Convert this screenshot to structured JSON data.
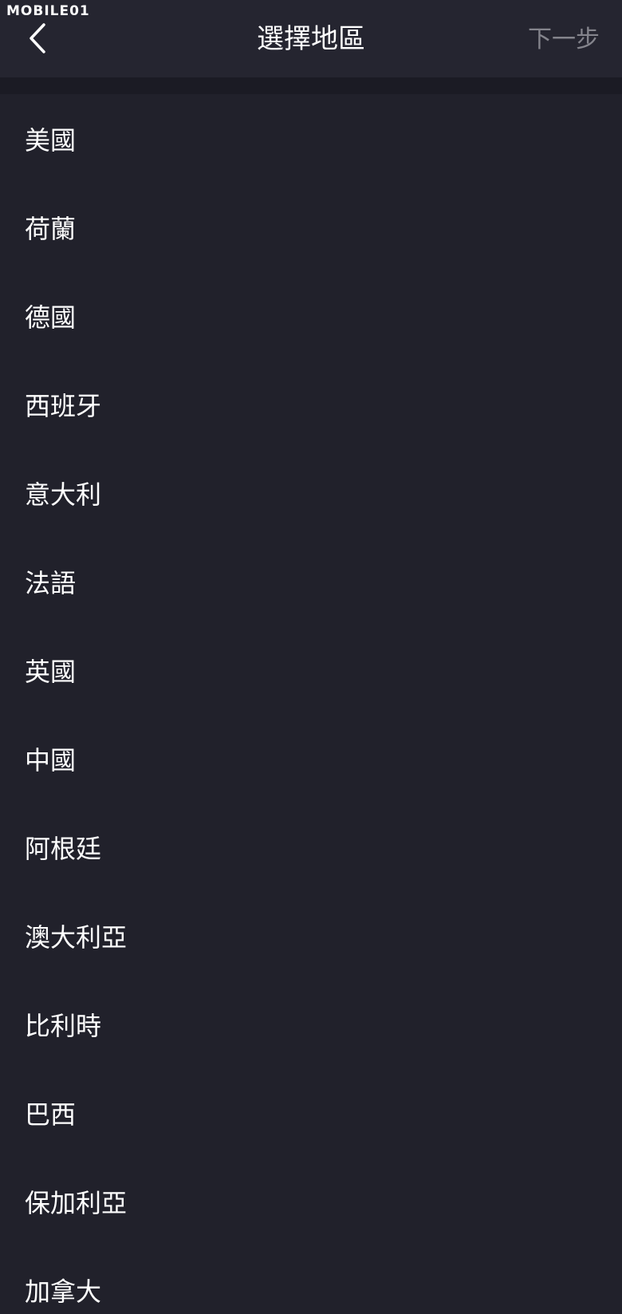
{
  "watermark": "MOBILE01",
  "header": {
    "back_icon": "chevron-left-icon",
    "title": "選擇地區",
    "next_label": "下一步"
  },
  "regions": [
    "美國",
    "荷蘭",
    "德國",
    "西班牙",
    "意大利",
    "法語",
    "英國",
    "中國",
    "阿根廷",
    "澳大利亞",
    "比利時",
    "巴西",
    "保加利亞",
    "加拿大"
  ],
  "colors": {
    "background": "#21212b",
    "header": "#252530",
    "divider": "#1b1b24",
    "text": "#ffffff",
    "disabled_text": "#84848c"
  }
}
